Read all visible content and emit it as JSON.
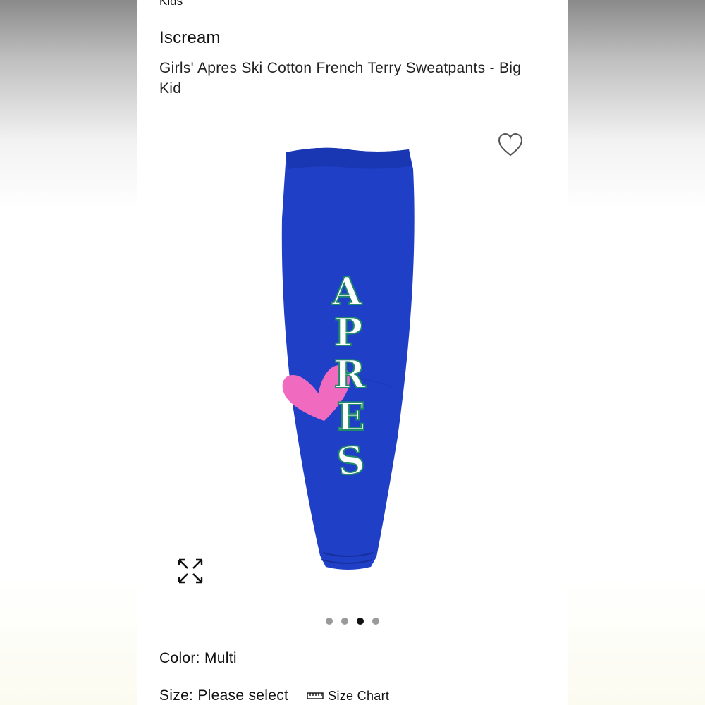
{
  "breadcrumb": {
    "label": "Kids"
  },
  "product": {
    "brand": "Iscream",
    "title": "Girls' Apres Ski Cotton French Terry Sweatpants - Big Kid",
    "print_text": [
      "A",
      "P",
      "R",
      "E",
      "S"
    ]
  },
  "gallery": {
    "dot_count": 4,
    "active_index": 2,
    "icons": {
      "wishlist": "heart-outline-icon",
      "expand": "expand-arrows-icon"
    }
  },
  "color": {
    "label": "Color:",
    "value": "Multi"
  },
  "size": {
    "label": "Size:",
    "value": "Please select",
    "chart_label": "Size Chart",
    "chart_icon": "ruler-icon"
  },
  "colors": {
    "pants": "#1f3fc7",
    "heart": "#f06ac0",
    "letter_fill": "#ffffff",
    "letter_outline": "#1f8a6a"
  }
}
